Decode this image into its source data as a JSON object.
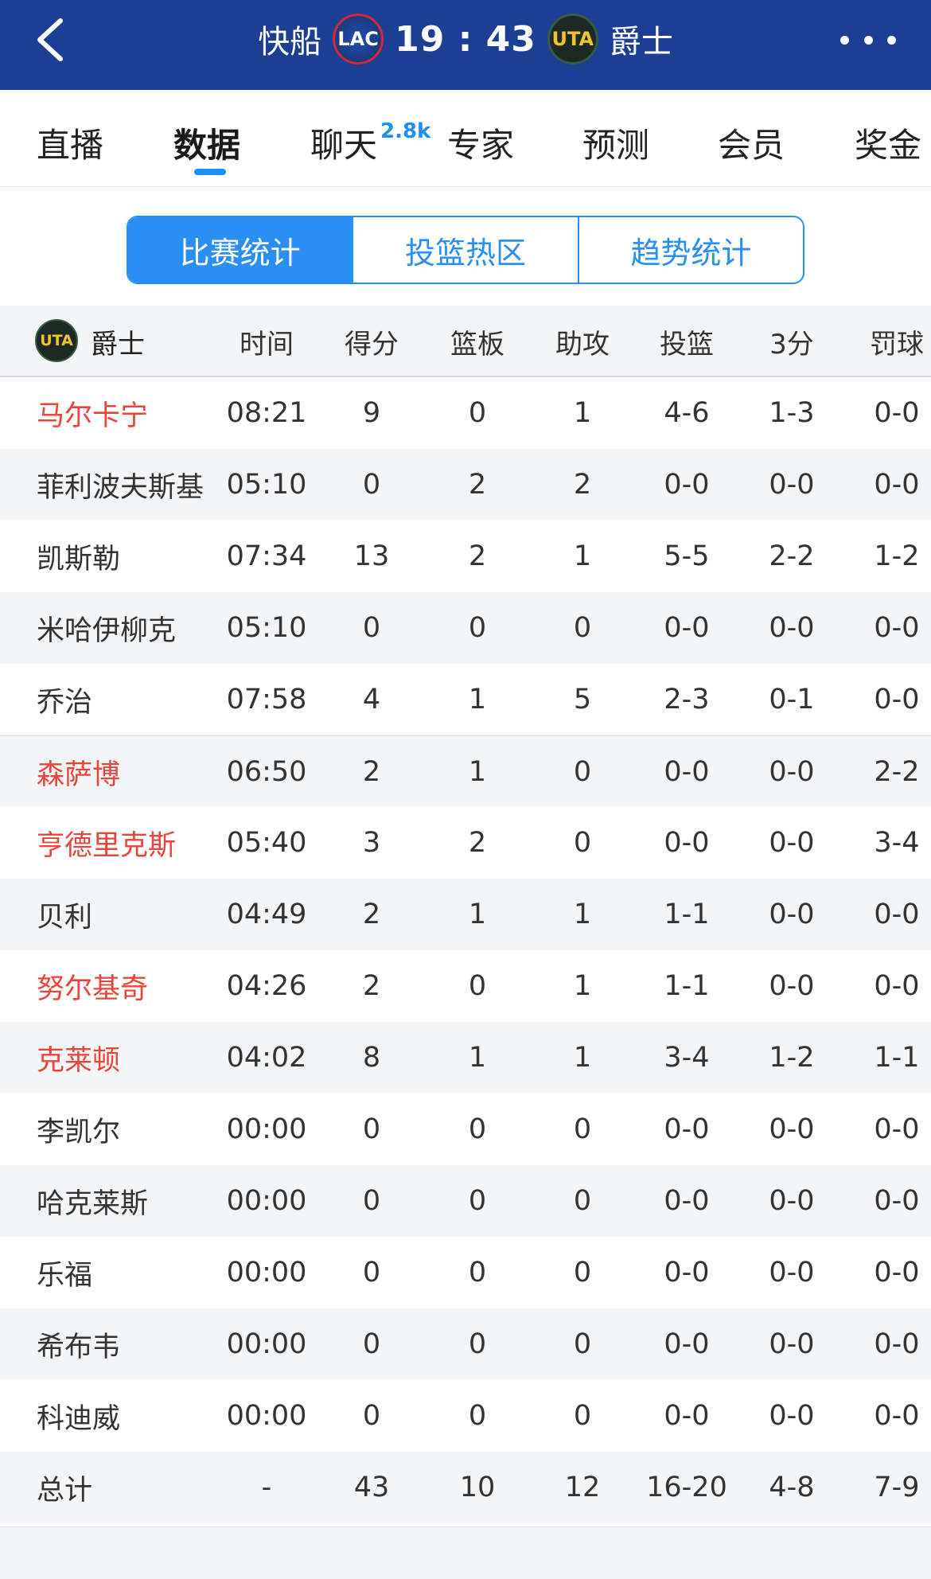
{
  "header": {
    "home_team": "快船",
    "home_logo_text": "LAC",
    "score": "19 : 43",
    "away_logo_text": "UTA",
    "away_team": "爵士",
    "back_icon": "chevron-left-icon",
    "more_icon": "more-horizontal-icon"
  },
  "tabs": [
    {
      "label": "直播"
    },
    {
      "label": "数据"
    },
    {
      "label": "聊天"
    },
    {
      "label": "专家"
    },
    {
      "label": "预测"
    },
    {
      "label": "会员"
    },
    {
      "label": "奖金"
    }
  ],
  "chat_badge": "2.8k",
  "segments": [
    {
      "label": "比赛统计"
    },
    {
      "label": "投篮热区"
    },
    {
      "label": "趋势统计"
    }
  ],
  "table": {
    "team_logo_text": "UTA",
    "team_label": "爵士",
    "columns": [
      "时间",
      "得分",
      "篮板",
      "助攻",
      "投篮",
      "3分",
      "罚球"
    ],
    "rows": [
      {
        "name": "马尔卡宁",
        "time": "08:21",
        "pts": "9",
        "reb": "0",
        "ast": "1",
        "fg": "4-6",
        "tp": "1-3",
        "ft": "0-0"
      },
      {
        "name": "菲利波夫斯基",
        "time": "05:10",
        "pts": "0",
        "reb": "2",
        "ast": "2",
        "fg": "0-0",
        "tp": "0-0",
        "ft": "0-0"
      },
      {
        "name": "凯斯勒",
        "time": "07:34",
        "pts": "13",
        "reb": "2",
        "ast": "1",
        "fg": "5-5",
        "tp": "2-2",
        "ft": "1-2"
      },
      {
        "name": "米哈伊柳克",
        "time": "05:10",
        "pts": "0",
        "reb": "0",
        "ast": "0",
        "fg": "0-0",
        "tp": "0-0",
        "ft": "0-0"
      },
      {
        "name": "乔治",
        "time": "07:58",
        "pts": "4",
        "reb": "1",
        "ast": "5",
        "fg": "2-3",
        "tp": "0-1",
        "ft": "0-0"
      },
      {
        "name": "森萨博",
        "time": "06:50",
        "pts": "2",
        "reb": "1",
        "ast": "0",
        "fg": "0-0",
        "tp": "0-0",
        "ft": "2-2"
      },
      {
        "name": "亨德里克斯",
        "time": "05:40",
        "pts": "3",
        "reb": "2",
        "ast": "0",
        "fg": "0-0",
        "tp": "0-0",
        "ft": "3-4"
      },
      {
        "name": "贝利",
        "time": "04:49",
        "pts": "2",
        "reb": "1",
        "ast": "1",
        "fg": "1-1",
        "tp": "0-0",
        "ft": "0-0"
      },
      {
        "name": "努尔基奇",
        "time": "04:26",
        "pts": "2",
        "reb": "0",
        "ast": "1",
        "fg": "1-1",
        "tp": "0-0",
        "ft": "0-0"
      },
      {
        "name": "克莱顿",
        "time": "04:02",
        "pts": "8",
        "reb": "1",
        "ast": "1",
        "fg": "3-4",
        "tp": "1-2",
        "ft": "1-1"
      },
      {
        "name": "李凯尔",
        "time": "00:00",
        "pts": "0",
        "reb": "0",
        "ast": "0",
        "fg": "0-0",
        "tp": "0-0",
        "ft": "0-0"
      },
      {
        "name": "哈克莱斯",
        "time": "00:00",
        "pts": "0",
        "reb": "0",
        "ast": "0",
        "fg": "0-0",
        "tp": "0-0",
        "ft": "0-0"
      },
      {
        "name": "乐福",
        "time": "00:00",
        "pts": "0",
        "reb": "0",
        "ast": "0",
        "fg": "0-0",
        "tp": "0-0",
        "ft": "0-0"
      },
      {
        "name": "希布韦",
        "time": "00:00",
        "pts": "0",
        "reb": "0",
        "ast": "0",
        "fg": "0-0",
        "tp": "0-0",
        "ft": "0-0"
      },
      {
        "name": "科迪威",
        "time": "00:00",
        "pts": "0",
        "reb": "0",
        "ast": "0",
        "fg": "0-0",
        "tp": "0-0",
        "ft": "0-0"
      }
    ],
    "total": {
      "name": "总计",
      "time": "-",
      "pts": "43",
      "reb": "10",
      "ast": "12",
      "fg": "16-20",
      "tp": "4-8",
      "ft": "7-9"
    }
  },
  "colors": {
    "header_bg": "#1c3f94",
    "accent": "#2a8ff5",
    "highlight_name": "#e8453c",
    "row_alt": "#f4f5f7"
  }
}
